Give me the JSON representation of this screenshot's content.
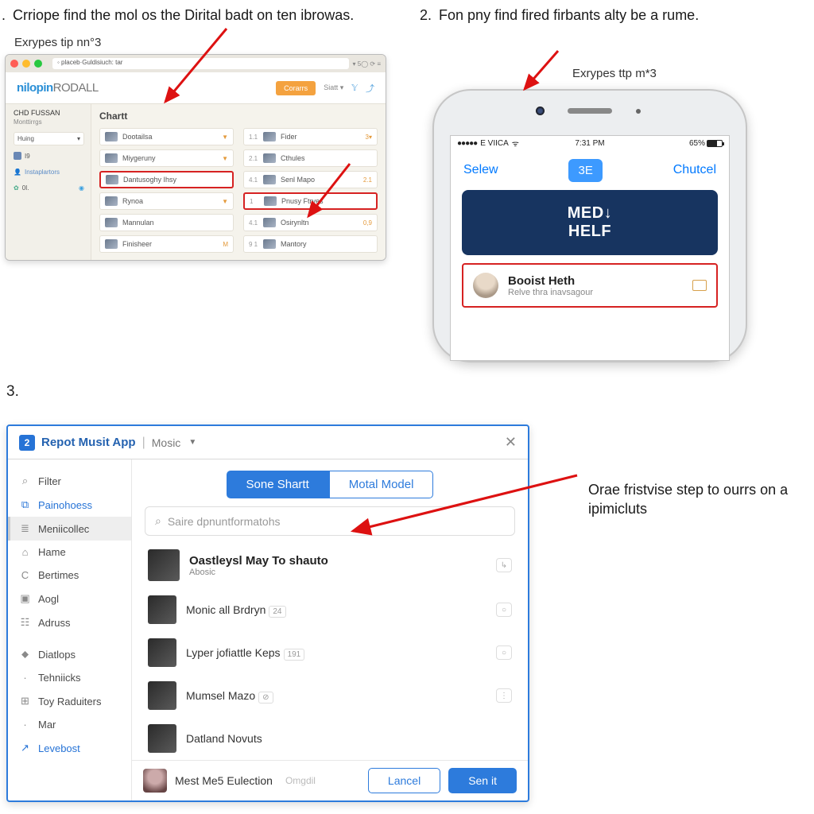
{
  "step1": {
    "num": ".",
    "text": "Crriope find the mol os the Dirital badt on ten ibrowas.",
    "tip": "Exrypes tip nn°3"
  },
  "step2": {
    "num": "2.",
    "text": "Fon pny find fired firbants alty be a rume.",
    "tip": "Exrypes ttp m*3"
  },
  "step3": {
    "num": "3.",
    "tip": "Orae fristvise step to ourrs on a ipimicluts"
  },
  "browser": {
    "url": "◦ placeb·Guldisiuch: tar",
    "tb_right": "▾ 5◯ ⟳ ≡",
    "logo_a": "nilopin",
    "logo_b": "RODALL",
    "btn_orange": "Corarrs",
    "siatt": "Siatt ▾",
    "side_head": "CHD FUSSAN",
    "side_sub": "Monttirrgs",
    "side_items": [
      "Huing",
      "I9",
      "Instaplartors",
      "0I."
    ],
    "main_head": "Chartt",
    "colA": [
      {
        "label": "Dootailsa",
        "v": "▼"
      },
      {
        "label": "Miygeruny",
        "v": "▼"
      },
      {
        "label": "Dantusoghy Ihsy",
        "v": ""
      },
      {
        "label": "Rynoa",
        "v": "▼"
      },
      {
        "label": "Mannulan",
        "v": ""
      },
      {
        "label": "Finisheer",
        "v": "M"
      }
    ],
    "colB": [
      {
        "idx": "1.1",
        "label": "Fider",
        "v": "3▾"
      },
      {
        "idx": "2.1",
        "label": "Cthules",
        "v": ""
      },
      {
        "idx": "4.1",
        "label": "Senl Mapo",
        "v": "2.1"
      },
      {
        "idx": "1",
        "label": "Pnusy Ftryes",
        "v": ""
      },
      {
        "idx": "4.1",
        "label": "Osirynltn",
        "v": "0,9"
      },
      {
        "idx": "9 1",
        "label": "Mantory",
        "v": ""
      }
    ]
  },
  "phone": {
    "carrier": "E VIICA",
    "time": "7:31 PM",
    "battery": "65%",
    "nav_left": "Selew",
    "nav_mid": "3E",
    "nav_right": "Chutcel",
    "banner_a": "MED↓",
    "banner_b": "HELF",
    "card_name": "Booist Heth",
    "card_sub": "Relve thra inavsagour"
  },
  "dialog": {
    "title_icon": "2",
    "title": "Repot Musit App",
    "title_sub": "Mosic",
    "side": [
      {
        "icon": "⌕",
        "label": "Filter",
        "link": false
      },
      {
        "icon": "⧉",
        "label": "Painohoess",
        "link": true
      },
      {
        "icon": "≣",
        "label": "Meniicollec",
        "link": false,
        "sel": true
      },
      {
        "icon": "⌂",
        "label": "Hame",
        "link": false
      },
      {
        "icon": "C",
        "label": "Bertimes",
        "link": false
      },
      {
        "icon": "▣",
        "label": "Aogl",
        "link": false
      },
      {
        "icon": "☷",
        "label": "Adruss",
        "link": false
      }
    ],
    "side2": [
      {
        "icon": "⬥",
        "label": "Diatlops",
        "link": false
      },
      {
        "icon": "·",
        "label": "Tehniicks",
        "link": false
      },
      {
        "icon": "⊞",
        "label": "Toy Raduiters",
        "link": false
      },
      {
        "icon": "·",
        "label": "Mar",
        "link": false
      },
      {
        "icon": "↗",
        "label": "Levebost",
        "link": true
      }
    ],
    "tab_a": "Sone Shartt",
    "tab_b": "Motal Model",
    "search_placeholder": "Saire dpnuntformatohs",
    "results": [
      {
        "title": "Oastleysl May To shauto",
        "sub": "Abosic",
        "end": "↳",
        "big": true
      },
      {
        "title": "Monic all Brdryn",
        "pill": "24",
        "end": "○"
      },
      {
        "title": "Lyper jofiattle Keps",
        "pill": "191",
        "end": "○"
      },
      {
        "title": "Mumsel Mazo",
        "pill": "⊘",
        "end": "⋮"
      },
      {
        "title": "Datland Novuts",
        "pill": "",
        "end": ""
      }
    ],
    "footer_name": "Mest Me5 Eulection",
    "footer_sub": "Omgdil",
    "btn_cancel": "Lancel",
    "btn_send": "Sen it"
  }
}
